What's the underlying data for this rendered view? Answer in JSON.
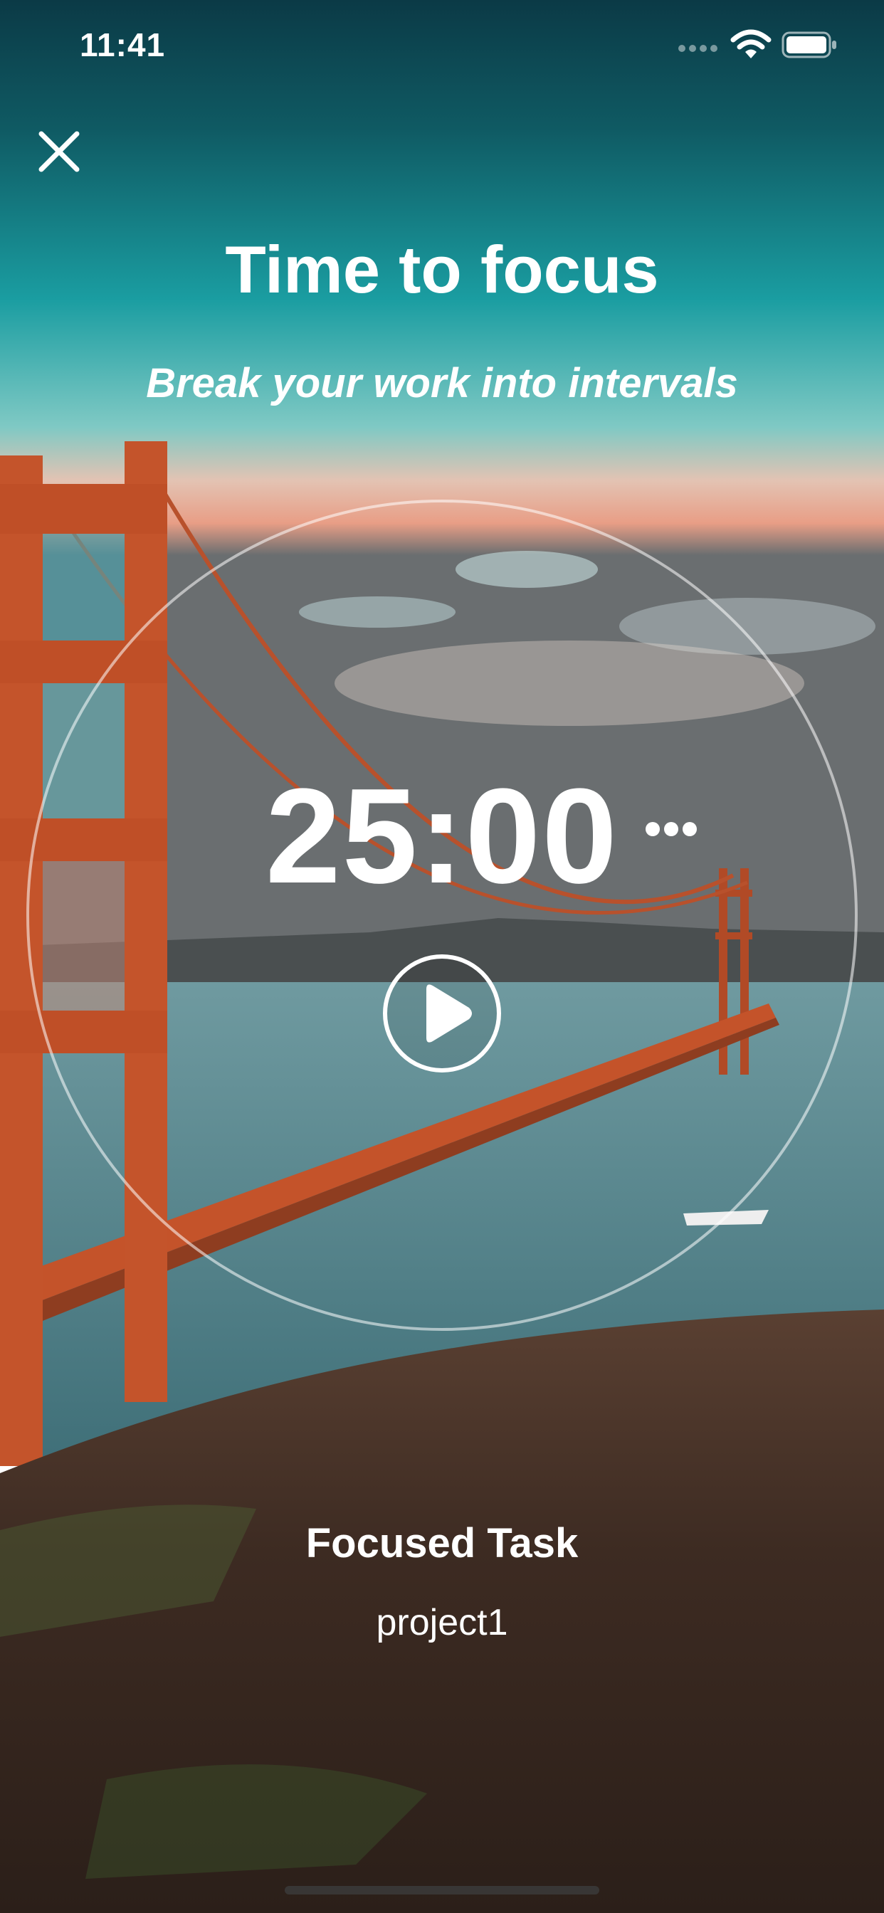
{
  "status_bar": {
    "time": "11:41"
  },
  "header": {
    "close_icon": "close-icon",
    "title": "Time to focus",
    "subtitle": "Break your work into intervals"
  },
  "timer": {
    "display": "25:00",
    "more_icon": "ellipsis-icon",
    "play_icon": "play-icon"
  },
  "task": {
    "label": "Focused Task",
    "name": "project1"
  },
  "colors": {
    "sky_top": "#0b3a46",
    "sky_teal": "#1aa3a3",
    "bridge": "#c84a22",
    "water": "#4b7d84",
    "hill": "#3d2b22"
  }
}
